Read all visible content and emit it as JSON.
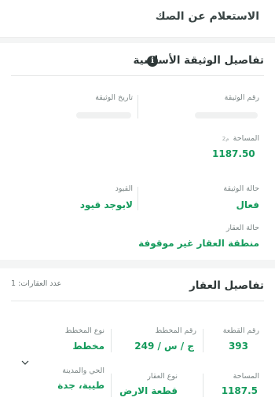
{
  "header": {
    "title": "الاستعلام عن الصك"
  },
  "deed_section": {
    "title": "تفاصيل الوثيقة الأساسية",
    "info_icon_glyph": "i",
    "fields": {
      "deed_number_label": "رقم الوثيقة",
      "deed_date_label": "تاريخ الوثيقة",
      "area_label": "المساحة",
      "area_unit": "م2",
      "area_value": "1187.50",
      "restrictions_label": "القيود",
      "restrictions_value": "لايوجد قيود",
      "deed_status_label": "حالة الوثيقة",
      "deed_status_value": "فعال",
      "property_status_label": "حالة العقار",
      "property_status_value": "منطقة العقار غير موقوفة"
    }
  },
  "property_section": {
    "title": "تفاصيل العقار",
    "count_label": "عدد العقارات: 1",
    "fields": {
      "plot_number_label": "رقم القطعة",
      "plot_number_value": "393",
      "plan_number_label": "رقم المخطط",
      "plan_number_value": "249 / ج / س",
      "plan_type_label": "نوع المخطط",
      "plan_type_value": "مخطط",
      "area_label": "المساحة",
      "area_value": "1187.5",
      "property_type_label": "نوع العقار",
      "property_type_value": "قطعة الارض",
      "district_city_label": "الحي والمدينة",
      "district_city_value": "طيبة، جدة"
    }
  },
  "colors": {
    "accent": "#159b5c",
    "text": "#2f3838",
    "label": "#7b8585"
  },
  "icons": {
    "info": "info-icon",
    "expand": "chevron-down-icon"
  }
}
